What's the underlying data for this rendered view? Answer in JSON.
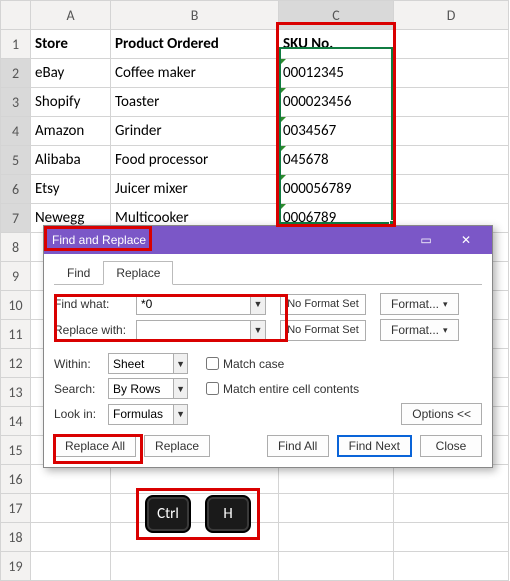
{
  "columns": [
    "A",
    "B",
    "C",
    "D"
  ],
  "rows": [
    "1",
    "2",
    "3",
    "4",
    "5",
    "6",
    "7",
    "8",
    "9",
    "10",
    "11",
    "12",
    "13",
    "14",
    "15",
    "16",
    "17",
    "18",
    "19"
  ],
  "header": {
    "a": "Store",
    "b": "Product Ordered",
    "c": "SKU No."
  },
  "data": [
    {
      "a": "eBay",
      "b": "Coffee maker",
      "c": "00012345"
    },
    {
      "a": "Shopify",
      "b": "Toaster",
      "c": "000023456"
    },
    {
      "a": "Amazon",
      "b": "Grinder",
      "c": "0034567"
    },
    {
      "a": "Alibaba",
      "b": "Food processor",
      "c": "045678"
    },
    {
      "a": "Etsy",
      "b": "Juicer mixer",
      "c": "000056789"
    },
    {
      "a": "Newegg",
      "b": "Multicooker",
      "c": "0006789"
    }
  ],
  "dialog": {
    "title": "Find and Replace",
    "tabs": {
      "find": "Find",
      "replace": "Replace"
    },
    "find_what_label": "Find what:",
    "find_what_value": "*0",
    "replace_with_label": "Replace with:",
    "replace_with_value": "",
    "no_format": "No Format Set",
    "format_btn": "Format...",
    "within_label": "Within:",
    "within_value": "Sheet",
    "search_label": "Search:",
    "search_value": "By Rows",
    "lookin_label": "Look in:",
    "lookin_value": "Formulas",
    "match_case": "Match case",
    "match_entire": "Match entire cell contents",
    "options_btn": "Options <<",
    "replace_all": "Replace All",
    "replace": "Replace",
    "find_all": "Find All",
    "find_next": "Find Next",
    "close": "Close"
  },
  "keys": {
    "ctrl": "Ctrl",
    "h": "H"
  }
}
